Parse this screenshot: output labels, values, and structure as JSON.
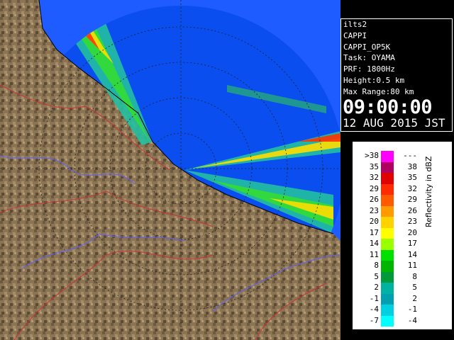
{
  "info": {
    "site": "ilts2",
    "product": "CAPPI",
    "product_id": "CAPPI_OP5K",
    "task": "Task: OYAMA",
    "prf": "PRF: 1800Hz",
    "height": "Height:0.5 km",
    "max_range": "Max Range:80 km",
    "time": "09:00:00",
    "date": "12 AUG 2015 JST"
  },
  "legend": {
    "title": "Reflectivity in dBZ",
    "rows": [
      {
        "lo": ">38",
        "hi": "---",
        "color": "#ff00ff"
      },
      {
        "lo": "35",
        "hi": "38",
        "color": "#b00060"
      },
      {
        "lo": "32",
        "hi": "35",
        "color": "#e00000"
      },
      {
        "lo": "29",
        "hi": "32",
        "color": "#ff2a00"
      },
      {
        "lo": "26",
        "hi": "29",
        "color": "#ff5a00"
      },
      {
        "lo": "23",
        "hi": "26",
        "color": "#ff9a00"
      },
      {
        "lo": "20",
        "hi": "23",
        "color": "#ffd200"
      },
      {
        "lo": "17",
        "hi": "20",
        "color": "#ffff00"
      },
      {
        "lo": "14",
        "hi": "17",
        "color": "#9aff00"
      },
      {
        "lo": "11",
        "hi": "14",
        "color": "#00e000"
      },
      {
        "lo": "8",
        "hi": "11",
        "color": "#00b400"
      },
      {
        "lo": "5",
        "hi": "8",
        "color": "#009a3a"
      },
      {
        "lo": "2",
        "hi": "5",
        "color": "#00b3a0"
      },
      {
        "lo": "-1",
        "hi": "2",
        "color": "#00a0b0"
      },
      {
        "lo": "-4",
        "hi": "-1",
        "color": "#00d0e0"
      },
      {
        "lo": "-7",
        "hi": "-4",
        "color": "#00ffff"
      }
    ]
  }
}
